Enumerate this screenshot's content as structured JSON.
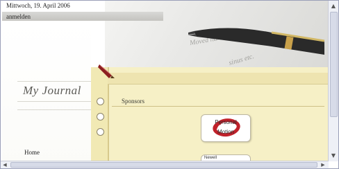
{
  "header": {
    "date": "Mittwoch, 19. April 2006",
    "login_label": "anmelden"
  },
  "left": {
    "title": "My Journal",
    "nav_items": [
      "Home"
    ]
  },
  "main": {
    "section_title": "Sponsors",
    "sponsor_1": {
      "line1": "Personal",
      "line2": "Motion"
    },
    "sponsor_2": {
      "partial_label": "Newell"
    }
  },
  "icons": {
    "pen": "quill-pen-icon",
    "hero": "fountain-pen-photo"
  }
}
